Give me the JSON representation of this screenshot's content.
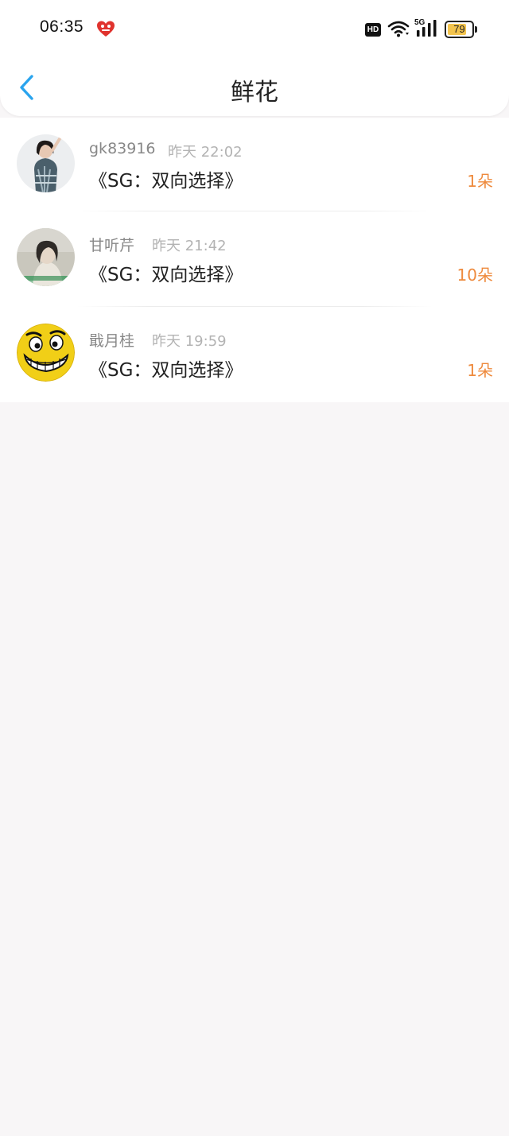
{
  "status_bar": {
    "time": "06:35",
    "app_icon": "red-heart-app-icon",
    "hd_label": "HD",
    "network_label": "5G",
    "battery_level": "79",
    "battery_fraction": 0.79
  },
  "nav": {
    "back_icon": "chevron-left-icon",
    "title": "鲜花"
  },
  "items": [
    {
      "user": "gk83916",
      "time": "昨天 22:02",
      "thread": "《SG：双向选择》",
      "count": "1朵",
      "avatar": "photo-avatar"
    },
    {
      "user": "甘听芹",
      "time": "昨天 21:42",
      "thread": "《SG：双向选择》",
      "count": "10朵",
      "avatar": "photo-avatar"
    },
    {
      "user": "戢月桂",
      "time": "昨天 19:59",
      "thread": "《SG：双向选择》",
      "count": "1朵",
      "avatar": "smiley-face-avatar"
    }
  ],
  "colors": {
    "accent_blue": "#2aa4ee",
    "count_orange": "#ee8a3d",
    "background": "#f8f6f7"
  }
}
